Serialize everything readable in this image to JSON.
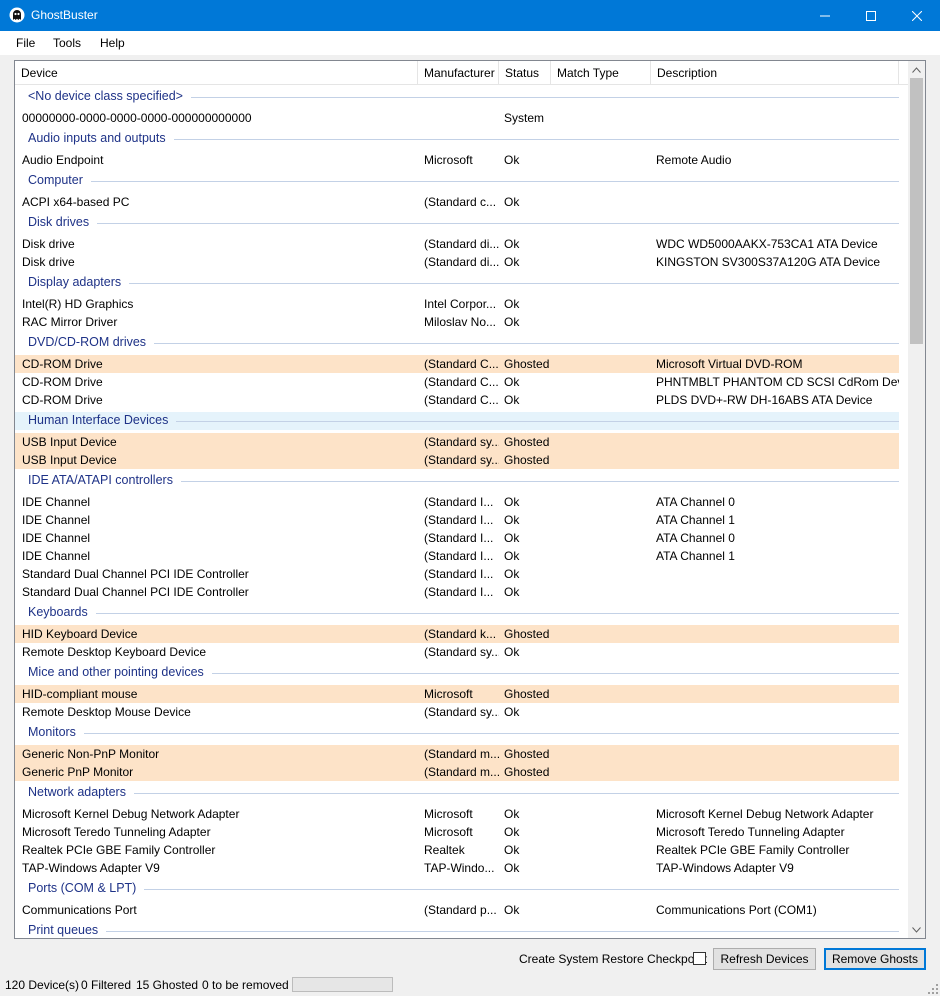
{
  "window": {
    "title": "GhostBuster",
    "minimize_glyph": "—",
    "maximize_glyph": "☐",
    "close_glyph": "✕"
  },
  "menu": [
    "File",
    "Tools",
    "Help"
  ],
  "columns": [
    "Device",
    "Manufacturer",
    "Status",
    "Match Type",
    "Description"
  ],
  "groups": [
    {
      "label": "<No device class specified>",
      "rows": [
        {
          "device": "00000000-0000-0000-0000-000000000000",
          "manufacturer": "",
          "status": "System",
          "match": "",
          "description": "",
          "ghosted": false
        }
      ]
    },
    {
      "label": "Audio inputs and outputs",
      "rows": [
        {
          "device": "Audio Endpoint",
          "manufacturer": "Microsoft",
          "status": "Ok",
          "match": "",
          "description": "Remote Audio",
          "ghosted": false
        }
      ]
    },
    {
      "label": "Computer",
      "rows": [
        {
          "device": "ACPI x64-based PC",
          "manufacturer": "(Standard c...",
          "status": "Ok",
          "match": "",
          "description": "",
          "ghosted": false
        }
      ]
    },
    {
      "label": "Disk drives",
      "rows": [
        {
          "device": "Disk drive",
          "manufacturer": "(Standard di...",
          "status": "Ok",
          "match": "",
          "description": "WDC WD5000AAKX-753CA1 ATA Device",
          "ghosted": false
        },
        {
          "device": "Disk drive",
          "manufacturer": "(Standard di...",
          "status": "Ok",
          "match": "",
          "description": "KINGSTON SV300S37A120G ATA Device",
          "ghosted": false
        }
      ]
    },
    {
      "label": "Display adapters",
      "rows": [
        {
          "device": "Intel(R) HD Graphics",
          "manufacturer": "Intel Corpor...",
          "status": "Ok",
          "match": "",
          "description": "",
          "ghosted": false
        },
        {
          "device": "RAC Mirror Driver",
          "manufacturer": "Miloslav No...",
          "status": "Ok",
          "match": "",
          "description": "",
          "ghosted": false
        }
      ]
    },
    {
      "label": "DVD/CD-ROM drives",
      "rows": [
        {
          "device": "CD-ROM Drive",
          "manufacturer": "(Standard C...",
          "status": "Ghosted",
          "match": "",
          "description": "Microsoft Virtual DVD-ROM",
          "ghosted": true
        },
        {
          "device": "CD-ROM Drive",
          "manufacturer": "(Standard C...",
          "status": "Ok",
          "match": "",
          "description": "PHNTMBLT PHANTOM CD SCSI CdRom Device",
          "ghosted": false
        },
        {
          "device": "CD-ROM Drive",
          "manufacturer": "(Standard C...",
          "status": "Ok",
          "match": "",
          "description": "PLDS DVD+-RW DH-16ABS ATA Device",
          "ghosted": false
        }
      ]
    },
    {
      "label": "Human Interface Devices",
      "highlighted": true,
      "rows": [
        {
          "device": "USB Input Device",
          "manufacturer": "(Standard sy...",
          "status": "Ghosted",
          "match": "",
          "description": "",
          "ghosted": true
        },
        {
          "device": "USB Input Device",
          "manufacturer": "(Standard sy...",
          "status": "Ghosted",
          "match": "",
          "description": "",
          "ghosted": true
        }
      ]
    },
    {
      "label": "IDE ATA/ATAPI controllers",
      "rows": [
        {
          "device": "IDE Channel",
          "manufacturer": "(Standard I...",
          "status": "Ok",
          "match": "",
          "description": "ATA Channel 0",
          "ghosted": false
        },
        {
          "device": "IDE Channel",
          "manufacturer": "(Standard I...",
          "status": "Ok",
          "match": "",
          "description": "ATA Channel 1",
          "ghosted": false
        },
        {
          "device": "IDE Channel",
          "manufacturer": "(Standard I...",
          "status": "Ok",
          "match": "",
          "description": "ATA Channel 0",
          "ghosted": false
        },
        {
          "device": "IDE Channel",
          "manufacturer": "(Standard I...",
          "status": "Ok",
          "match": "",
          "description": "ATA Channel 1",
          "ghosted": false
        },
        {
          "device": "Standard Dual Channel PCI IDE Controller",
          "manufacturer": "(Standard I...",
          "status": "Ok",
          "match": "",
          "description": "",
          "ghosted": false
        },
        {
          "device": "Standard Dual Channel PCI IDE Controller",
          "manufacturer": "(Standard I...",
          "status": "Ok",
          "match": "",
          "description": "",
          "ghosted": false
        }
      ]
    },
    {
      "label": "Keyboards",
      "rows": [
        {
          "device": "HID Keyboard Device",
          "manufacturer": "(Standard k...",
          "status": "Ghosted",
          "match": "",
          "description": "",
          "ghosted": true
        },
        {
          "device": "Remote Desktop Keyboard Device",
          "manufacturer": "(Standard sy...",
          "status": "Ok",
          "match": "",
          "description": "",
          "ghosted": false
        }
      ]
    },
    {
      "label": "Mice and other pointing devices",
      "rows": [
        {
          "device": "HID-compliant mouse",
          "manufacturer": "Microsoft",
          "status": "Ghosted",
          "match": "",
          "description": "",
          "ghosted": true
        },
        {
          "device": "Remote Desktop Mouse Device",
          "manufacturer": "(Standard sy...",
          "status": "Ok",
          "match": "",
          "description": "",
          "ghosted": false
        }
      ]
    },
    {
      "label": "Monitors",
      "rows": [
        {
          "device": "Generic Non-PnP Monitor",
          "manufacturer": "(Standard m...",
          "status": "Ghosted",
          "match": "",
          "description": "",
          "ghosted": true
        },
        {
          "device": "Generic PnP Monitor",
          "manufacturer": "(Standard m...",
          "status": "Ghosted",
          "match": "",
          "description": "",
          "ghosted": true
        }
      ]
    },
    {
      "label": "Network adapters",
      "rows": [
        {
          "device": "Microsoft Kernel Debug Network Adapter",
          "manufacturer": "Microsoft",
          "status": "Ok",
          "match": "",
          "description": "Microsoft Kernel Debug Network Adapter",
          "ghosted": false
        },
        {
          "device": "Microsoft Teredo Tunneling Adapter",
          "manufacturer": "Microsoft",
          "status": "Ok",
          "match": "",
          "description": "Microsoft Teredo Tunneling Adapter",
          "ghosted": false
        },
        {
          "device": "Realtek PCIe GBE Family Controller",
          "manufacturer": "Realtek",
          "status": "Ok",
          "match": "",
          "description": "Realtek PCIe GBE Family Controller",
          "ghosted": false
        },
        {
          "device": "TAP-Windows Adapter V9",
          "manufacturer": "TAP-Windo...",
          "status": "Ok",
          "match": "",
          "description": "TAP-Windows Adapter V9",
          "ghosted": false
        }
      ]
    },
    {
      "label": "Ports (COM & LPT)",
      "rows": [
        {
          "device": "Communications Port",
          "manufacturer": "(Standard p...",
          "status": "Ok",
          "match": "",
          "description": "Communications Port (COM1)",
          "ghosted": false
        }
      ]
    },
    {
      "label": "Print queues",
      "rows": []
    }
  ],
  "footer": {
    "restore_checkpoint_label": "Create System Restore Checkpoint",
    "restore_checkpoint_checked": false,
    "refresh_label": "Refresh Devices",
    "remove_label": "Remove Ghosts"
  },
  "status": {
    "devices": "120 Device(s)",
    "filtered": "0 Filtered",
    "ghosted": "15 Ghosted",
    "to_remove": "0 to be removed",
    "progress": 0
  },
  "colors": {
    "titlebar": "#0078d7",
    "ghosted_row": "#fde3c8",
    "group_label": "#1e3287",
    "group_highlight": "#e5f3fb"
  }
}
